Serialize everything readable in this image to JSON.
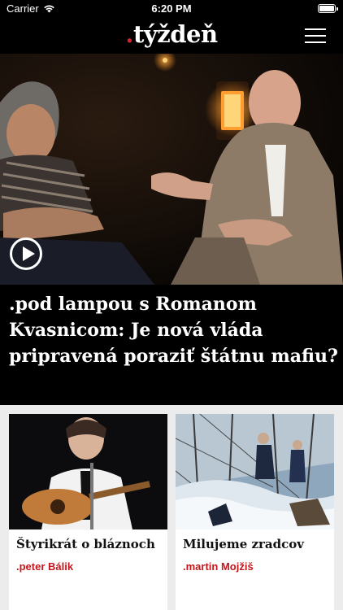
{
  "status_bar": {
    "carrier": "Carrier",
    "time": "6:20 PM"
  },
  "header": {
    "logo_dot": ".",
    "logo_text": "týždeň",
    "menu_icon": "hamburger-menu-icon"
  },
  "hero": {
    "title": ".pod lampou s Romanom Kvasnicom: Je nová vláda pripravená poraziť štátnu mafiu?",
    "play_icon": "play-circle-icon"
  },
  "cards": [
    {
      "title": "Štyrikrát o bláznoch",
      "author": ".peter Bálik"
    },
    {
      "title": "Milujeme zradcov",
      "author": ".martin Mojžiš"
    }
  ],
  "colors": {
    "accent": "#d7222c",
    "background": "#000000",
    "card_background": "#ffffff",
    "grid_background": "#ececec"
  }
}
